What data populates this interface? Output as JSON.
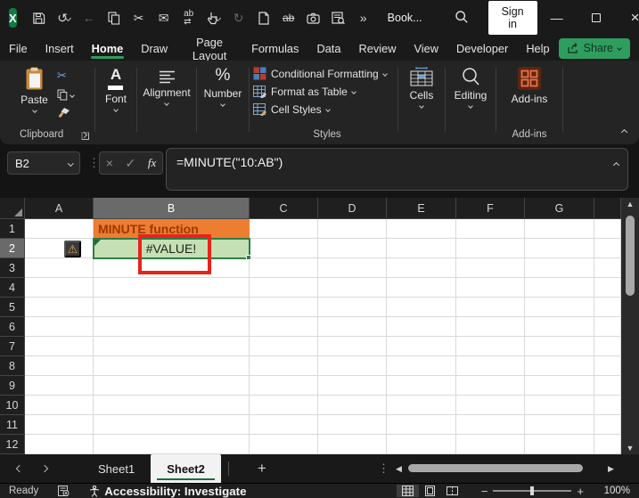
{
  "titlebar": {
    "logo_glyph": "X",
    "document_title": "Book...",
    "sign_in_label": "Sign in",
    "qat_icons": [
      "save",
      "undo",
      "back",
      "copy",
      "cut",
      "mail",
      "find-replace",
      "touch-mode",
      "redo",
      "new-file",
      "strikethrough",
      "camera",
      "lookup",
      "more-commands"
    ],
    "more_commands_glyph": "»"
  },
  "ribbon": {
    "tabs": [
      {
        "label": "File"
      },
      {
        "label": "Insert"
      },
      {
        "label": "Home",
        "active": true
      },
      {
        "label": "Draw"
      },
      {
        "label": "Page Layout"
      },
      {
        "label": "Formulas"
      },
      {
        "label": "Data"
      },
      {
        "label": "Review"
      },
      {
        "label": "View"
      },
      {
        "label": "Developer"
      },
      {
        "label": "Help"
      }
    ],
    "share_label": "Share",
    "clipboard": {
      "paste_label": "Paste",
      "group_label": "Clipboard"
    },
    "font_label": "Font",
    "alignment_label": "Alignment",
    "number_label": "Number",
    "styles": {
      "items": [
        {
          "label": "Conditional Formatting"
        },
        {
          "label": "Format as Table"
        },
        {
          "label": "Cell Styles"
        }
      ],
      "group_label": "Styles"
    },
    "cells_label": "Cells",
    "editing_label": "Editing",
    "addins": {
      "button_label": "Add-ins",
      "group_label": "Add-ins"
    }
  },
  "formula_bar": {
    "name_box": "B2",
    "cancel_glyph": "×",
    "enter_glyph": "✓",
    "fx_label": "fx",
    "formula": "=MINUTE(\"10:AB\")"
  },
  "grid": {
    "column_headers": [
      "A",
      "B",
      "C",
      "D",
      "E",
      "F",
      "G"
    ],
    "row_headers": [
      "1",
      "2",
      "3",
      "4",
      "5",
      "6",
      "7",
      "8",
      "9",
      "10",
      "11",
      "12"
    ],
    "selected_column": "B",
    "selected_row": "2",
    "selected_cell": "B2",
    "b1": {
      "cell": "B1",
      "text": "MINUTE function",
      "bg": "#ED7D31",
      "text_color": "#9C3900"
    },
    "b2": {
      "cell": "B2",
      "text": "#VALUE!",
      "bg": "#C5E0B4",
      "text_color": "#1D1D1D"
    },
    "warning_glyph": "⚠",
    "annotation_color": "#E8231A"
  },
  "sheet_bar": {
    "sheets": [
      {
        "label": "Sheet1"
      },
      {
        "label": "Sheet2",
        "active": true
      }
    ],
    "add_sheet_glyph": "+"
  },
  "status_bar": {
    "mode": "Ready",
    "accessibility": "Accessibility: Investigate",
    "zoom_level": "100%"
  },
  "colors": {
    "accent_green": "#107C41",
    "share_green": "#2E9E5F",
    "selection_green": "#2E7D46",
    "cell_orange": "#ED7D31",
    "cell_green": "#C5E0B4",
    "annotation_red": "#E8231A",
    "titlebar_bg": "#1A1A1A",
    "ribbon_bg": "#242424"
  }
}
